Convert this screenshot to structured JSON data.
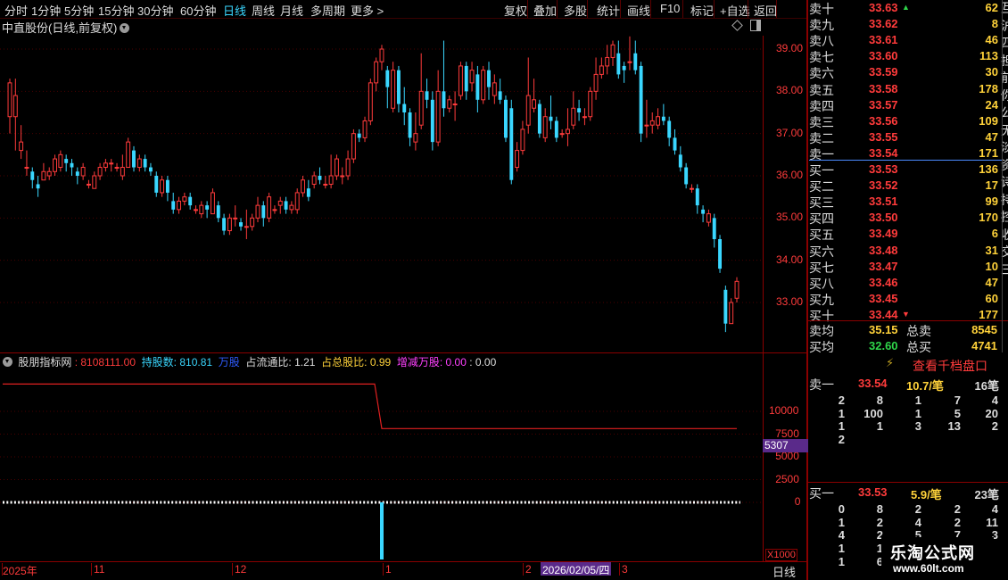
{
  "toolbar": {
    "left_items": [
      "分时",
      "1分钟",
      "5分钟",
      "15分钟",
      "30分钟",
      "60分钟",
      "日线",
      "周线",
      "月线",
      "多周期",
      "更多 >"
    ],
    "active_item": "日线",
    "right_items": [
      "复权",
      "叠加",
      "多股",
      "统计",
      "画线",
      "F10",
      "标记",
      "+自选",
      "返回"
    ]
  },
  "chart_title": "中直股份(日线,前复权)",
  "price_axis": [
    "39.00",
    "38.00",
    "37.00",
    "36.00",
    "35.00",
    "34.00",
    "33.00"
  ],
  "orderbook": {
    "sells": [
      {
        "label": "卖十",
        "price": "33.63",
        "vol": "62",
        "mark": "up"
      },
      {
        "label": "卖九",
        "price": "33.62",
        "vol": "8"
      },
      {
        "label": "卖八",
        "price": "33.61",
        "vol": "46"
      },
      {
        "label": "卖七",
        "price": "33.60",
        "vol": "113"
      },
      {
        "label": "卖六",
        "price": "33.59",
        "vol": "30"
      },
      {
        "label": "卖五",
        "price": "33.58",
        "vol": "178"
      },
      {
        "label": "卖四",
        "price": "33.57",
        "vol": "24"
      },
      {
        "label": "卖三",
        "price": "33.56",
        "vol": "109"
      },
      {
        "label": "卖二",
        "price": "33.55",
        "vol": "47"
      },
      {
        "label": "卖一",
        "price": "33.54",
        "vol": "171"
      }
    ],
    "buys": [
      {
        "label": "买一",
        "price": "33.53",
        "vol": "136"
      },
      {
        "label": "买二",
        "price": "33.52",
        "vol": "17"
      },
      {
        "label": "买三",
        "price": "33.51",
        "vol": "99"
      },
      {
        "label": "买四",
        "price": "33.50",
        "vol": "170"
      },
      {
        "label": "买五",
        "price": "33.49",
        "vol": "6"
      },
      {
        "label": "买六",
        "price": "33.48",
        "vol": "31"
      },
      {
        "label": "买七",
        "price": "33.47",
        "vol": "10"
      },
      {
        "label": "买八",
        "price": "33.46",
        "vol": "47"
      },
      {
        "label": "买九",
        "price": "33.45",
        "vol": "60"
      },
      {
        "label": "买十",
        "price": "33.44",
        "vol": "177",
        "mark": "down"
      }
    ],
    "sell_avg_label": "卖均",
    "sell_avg": "35.15",
    "total_sell_label": "总卖",
    "total_sell": "8545",
    "buy_avg_label": "买均",
    "buy_avg": "32.60",
    "total_buy_label": "总买",
    "total_buy": "4741"
  },
  "right_edge_chars": "互沪四担前你公无淡资诗持控收交三",
  "level_button": "查看千档盘口",
  "queue": {
    "sell_label": "卖一",
    "sell_price": "33.54",
    "sell_per": "10.7/笔",
    "sell_count": "16笔",
    "sell_grid": [
      [
        "2",
        "8",
        "1",
        "7",
        "4"
      ],
      [
        "1",
        "100",
        "1",
        "5",
        "20"
      ],
      [
        "1",
        "1",
        "3",
        "13",
        "2"
      ],
      [
        "2",
        "",
        "",
        "",
        ""
      ]
    ],
    "buy_label": "买一",
    "buy_price": "33.53",
    "buy_per": "5.9/笔",
    "buy_count": "23笔",
    "buy_grid": [
      [
        "0",
        "8",
        "2",
        "2",
        "4"
      ],
      [
        "1",
        "2",
        "4",
        "2",
        "11"
      ],
      [
        "4",
        "2",
        "5",
        "7",
        "3"
      ],
      [
        "1",
        "1",
        "",
        "",
        ""
      ],
      [
        "1",
        "6",
        "",
        "",
        ""
      ]
    ]
  },
  "indicator": {
    "name": "股朋指标网",
    "value1": ": 8108111.00",
    "holders_label": "持股数:",
    "holders_val": "810.81",
    "unit": "万股",
    "float_label": "占流通比:",
    "float_val": "1.21",
    "total_label": "占总股比:",
    "total_val": "0.99",
    "change_label": "增减万股:",
    "change_val": "0.00",
    "change_val2": ": 0.00"
  },
  "sub_axis": [
    "10000",
    "7500",
    "5000",
    "2500",
    "0"
  ],
  "sub_badge": "5307",
  "sub_scale": "X1000",
  "date_axis": {
    "start": "2025年",
    "m11": "11",
    "m12": "12",
    "m1": "1",
    "m2": "2",
    "cursor": "2026/02/05/四",
    "m3": "3",
    "period": "日线"
  },
  "watermark": {
    "title": "乐淘公式网",
    "url": "www.60lt.com"
  },
  "chart_data": {
    "type": "candlestick",
    "ylim": [
      32.3,
      39.3
    ],
    "candles": [
      [
        37.4,
        38.2,
        37.0,
        38.3
      ],
      [
        37.4,
        37.9,
        36.6,
        38.3
      ],
      [
        36.6,
        36.8,
        36.4,
        37.2
      ],
      [
        36.2,
        36.2,
        36.0,
        36.6
      ],
      [
        36.1,
        35.9,
        35.7,
        36.2
      ],
      [
        35.8,
        35.7,
        35.5,
        36.0
      ],
      [
        35.9,
        36.1,
        35.9,
        36.3
      ],
      [
        36.0,
        36.1,
        35.9,
        36.2
      ],
      [
        36.1,
        36.4,
        36.0,
        36.5
      ],
      [
        36.2,
        36.5,
        36.1,
        36.6
      ],
      [
        36.4,
        36.3,
        36.1,
        36.5
      ],
      [
        36.3,
        36.2,
        36.0,
        36.4
      ],
      [
        36.1,
        36.0,
        35.8,
        36.2
      ],
      [
        36.0,
        36.2,
        35.9,
        36.3
      ],
      [
        35.8,
        35.8,
        35.7,
        35.9
      ],
      [
        35.7,
        36.0,
        35.7,
        36.1
      ],
      [
        36.0,
        36.2,
        35.9,
        36.3
      ],
      [
        36.2,
        36.3,
        36.1,
        36.4
      ],
      [
        36.3,
        36.3,
        36.1,
        36.4
      ],
      [
        36.2,
        36.2,
        36.1,
        36.3
      ],
      [
        36.0,
        36.2,
        35.9,
        36.5
      ],
      [
        36.2,
        36.8,
        36.2,
        36.9
      ],
      [
        36.6,
        36.2,
        36.1,
        36.7
      ],
      [
        36.2,
        36.4,
        36.1,
        36.5
      ],
      [
        36.4,
        36.2,
        36.1,
        36.5
      ],
      [
        36.2,
        36.1,
        36.0,
        36.3
      ],
      [
        36.0,
        35.6,
        35.5,
        36.1
      ],
      [
        35.6,
        35.9,
        35.5,
        36.0
      ],
      [
        35.9,
        35.6,
        35.4,
        36.0
      ],
      [
        35.4,
        35.2,
        35.1,
        35.6
      ],
      [
        35.2,
        35.4,
        35.1,
        35.5
      ],
      [
        35.4,
        35.5,
        35.3,
        35.6
      ],
      [
        35.5,
        35.3,
        35.2,
        35.6
      ],
      [
        35.2,
        35.2,
        35.1,
        35.3
      ],
      [
        35.1,
        35.3,
        35.0,
        35.4
      ],
      [
        35.3,
        35.2,
        35.0,
        35.4
      ],
      [
        35.1,
        35.6,
        35.1,
        35.7
      ],
      [
        35.3,
        35.0,
        34.9,
        35.4
      ],
      [
        35.0,
        34.7,
        34.6,
        35.1
      ],
      [
        34.7,
        35.0,
        34.6,
        35.1
      ],
      [
        35.0,
        35.0,
        34.8,
        35.3
      ],
      [
        34.9,
        34.8,
        34.7,
        35.0
      ],
      [
        34.8,
        34.8,
        34.5,
        35.2
      ],
      [
        34.8,
        35.0,
        34.7,
        35.1
      ],
      [
        35.0,
        35.3,
        34.9,
        35.5
      ],
      [
        35.3,
        35.0,
        34.8,
        35.4
      ],
      [
        35.0,
        35.5,
        34.9,
        35.6
      ],
      [
        35.2,
        35.2,
        35.1,
        35.3
      ],
      [
        35.3,
        35.4,
        35.1,
        35.5
      ],
      [
        35.4,
        35.2,
        35.1,
        35.5
      ],
      [
        35.2,
        35.3,
        35.1,
        35.4
      ],
      [
        35.2,
        35.6,
        35.1,
        35.7
      ],
      [
        35.6,
        35.9,
        35.5,
        36.0
      ],
      [
        35.7,
        35.5,
        35.4,
        35.9
      ],
      [
        35.8,
        36.0,
        35.7,
        36.1
      ],
      [
        36.0,
        35.9,
        35.8,
        36.2
      ],
      [
        35.8,
        35.8,
        35.7,
        36.0
      ],
      [
        35.8,
        36.0,
        35.7,
        36.5
      ],
      [
        36.0,
        36.4,
        35.9,
        36.5
      ],
      [
        36.0,
        36.0,
        35.8,
        36.2
      ],
      [
        36.0,
        36.4,
        35.9,
        36.6
      ],
      [
        36.4,
        37.0,
        36.3,
        37.1
      ],
      [
        37.0,
        36.9,
        36.8,
        37.1
      ],
      [
        36.9,
        37.3,
        36.8,
        37.4
      ],
      [
        37.3,
        38.2,
        37.2,
        38.3
      ],
      [
        38.2,
        38.7,
        38.0,
        38.8
      ],
      [
        38.7,
        39.0,
        38.5,
        39.1
      ],
      [
        38.5,
        38.1,
        37.6,
        38.6
      ],
      [
        37.6,
        38.5,
        37.5,
        38.7
      ],
      [
        38.5,
        37.7,
        37.5,
        38.6
      ],
      [
        37.7,
        37.5,
        37.2,
        38.1
      ],
      [
        37.5,
        36.9,
        36.7,
        37.6
      ],
      [
        36.8,
        37.0,
        36.6,
        37.5
      ],
      [
        37.2,
        38.0,
        37.1,
        38.9
      ],
      [
        38.0,
        37.8,
        37.6,
        38.3
      ],
      [
        37.8,
        36.8,
        36.6,
        38.0
      ],
      [
        36.8,
        38.0,
        36.7,
        38.5
      ],
      [
        38.0,
        37.6,
        37.4,
        39.2
      ],
      [
        37.6,
        37.8,
        37.5,
        37.9
      ],
      [
        37.7,
        37.7,
        37.3,
        38.0
      ],
      [
        37.9,
        38.6,
        37.8,
        38.7
      ],
      [
        38.6,
        38.0,
        37.8,
        38.7
      ],
      [
        38.2,
        38.5,
        38.0,
        38.7
      ],
      [
        38.4,
        37.8,
        37.5,
        38.6
      ],
      [
        37.8,
        38.5,
        37.7,
        38.6
      ],
      [
        38.5,
        38.1,
        37.8,
        38.7
      ],
      [
        37.9,
        38.2,
        37.7,
        38.4
      ],
      [
        38.0,
        37.8,
        37.7,
        38.3
      ],
      [
        37.8,
        36.9,
        36.8,
        37.9
      ],
      [
        37.6,
        35.9,
        35.8,
        37.8
      ],
      [
        36.2,
        36.6,
        36.1,
        36.8
      ],
      [
        36.6,
        37.1,
        36.5,
        37.3
      ],
      [
        37.2,
        37.9,
        37.0,
        38.8
      ],
      [
        37.6,
        37.8,
        37.5,
        38.3
      ],
      [
        37.7,
        37.0,
        36.9,
        37.8
      ],
      [
        36.9,
        37.4,
        36.8,
        37.6
      ],
      [
        37.4,
        37.3,
        37.1,
        37.9
      ],
      [
        37.3,
        36.9,
        36.8,
        37.4
      ],
      [
        37.0,
        37.0,
        36.9,
        37.1
      ],
      [
        37.0,
        37.1,
        36.7,
        37.6
      ],
      [
        37.2,
        37.6,
        37.1,
        38.0
      ],
      [
        37.6,
        37.5,
        37.3,
        37.8
      ],
      [
        37.4,
        37.4,
        37.2,
        37.6
      ],
      [
        37.4,
        38.0,
        37.3,
        38.1
      ],
      [
        38.0,
        38.4,
        37.8,
        38.8
      ],
      [
        38.4,
        38.6,
        38.3,
        38.8
      ],
      [
        38.6,
        38.8,
        38.4,
        39.1
      ],
      [
        38.8,
        39.1,
        38.6,
        39.2
      ],
      [
        38.9,
        38.4,
        38.3,
        39.2
      ],
      [
        38.6,
        38.5,
        38.2,
        38.7
      ],
      [
        38.7,
        38.7,
        38.5,
        39.3
      ],
      [
        38.9,
        38.5,
        38.4,
        39.2
      ],
      [
        38.6,
        37.0,
        36.8,
        38.7
      ],
      [
        37.2,
        37.2,
        36.9,
        37.8
      ],
      [
        37.2,
        37.3,
        37.0,
        37.5
      ],
      [
        37.2,
        37.4,
        37.1,
        37.6
      ],
      [
        37.4,
        37.3,
        37.2,
        37.7
      ],
      [
        37.3,
        36.9,
        36.7,
        37.4
      ],
      [
        36.9,
        36.6,
        36.5,
        37.1
      ],
      [
        36.5,
        36.2,
        36.1,
        36.7
      ],
      [
        36.2,
        35.8,
        35.7,
        36.3
      ],
      [
        35.7,
        35.7,
        35.6,
        35.8
      ],
      [
        35.7,
        35.3,
        35.1,
        35.8
      ],
      [
        35.2,
        35.1,
        34.9,
        35.3
      ],
      [
        34.9,
        35.1,
        34.8,
        35.2
      ],
      [
        35.0,
        34.5,
        34.3,
        35.1
      ],
      [
        34.5,
        33.8,
        33.7,
        34.6
      ],
      [
        33.3,
        32.5,
        32.3,
        33.4
      ],
      [
        32.5,
        33.0,
        32.5,
        33.1
      ],
      [
        33.1,
        33.5,
        33.0,
        33.6
      ]
    ],
    "sub_series": [
      {
        "name": "持股数",
        "values_before": 13000,
        "values_after": 8108
      }
    ]
  }
}
